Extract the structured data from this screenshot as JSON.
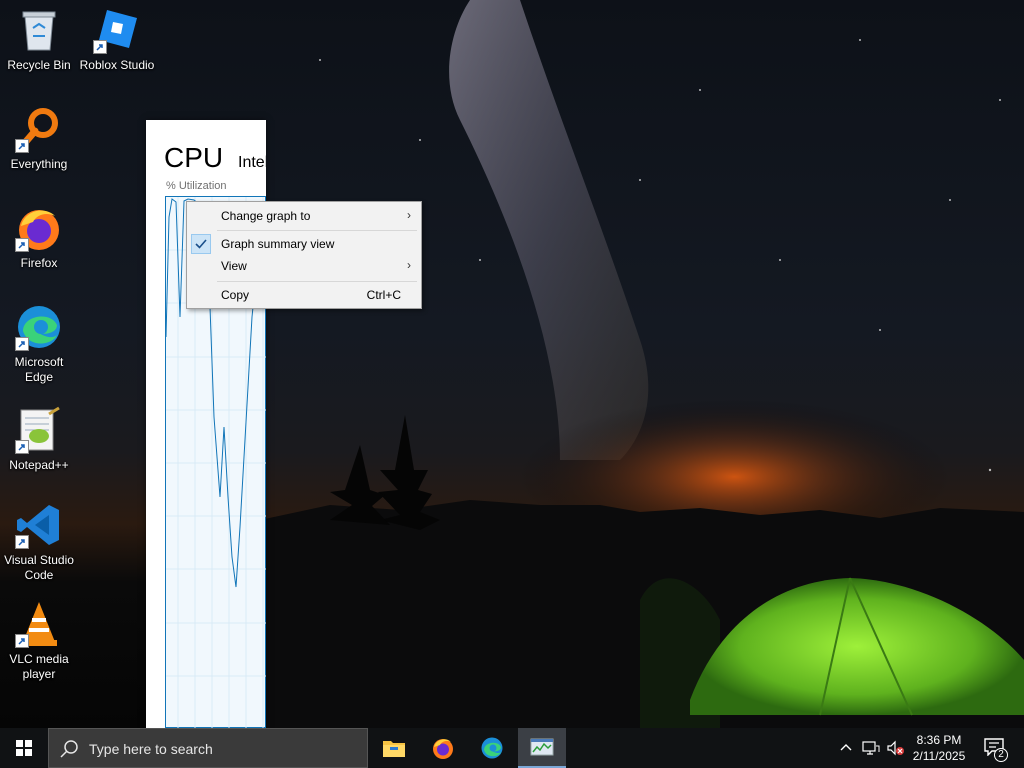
{
  "desktop": {
    "icons": [
      {
        "label": "Recycle Bin",
        "icon": "recycle-bin-icon"
      },
      {
        "label": "Roblox Studio",
        "icon": "roblox-studio-icon"
      },
      {
        "label": "Everything",
        "icon": "everything-search-icon"
      },
      {
        "label": "Firefox",
        "icon": "firefox-icon"
      },
      {
        "label": "Microsoft Edge",
        "icon": "edge-icon"
      },
      {
        "label": "Notepad++",
        "icon": "notepadpp-icon"
      },
      {
        "label": "Visual Studio Code",
        "icon": "vscode-icon"
      },
      {
        "label": "VLC media player",
        "icon": "vlc-icon"
      }
    ]
  },
  "task_manager": {
    "section_title": "CPU",
    "cpu_name_partial": "Intel",
    "utilization_label": "% Utilization",
    "graph_color": "#1175b8"
  },
  "context_menu": {
    "items": [
      {
        "label": "Change graph to",
        "submenu": true
      },
      {
        "label": "Graph summary view",
        "checked": true
      },
      {
        "label": "View",
        "submenu": true
      },
      {
        "label": "Copy",
        "shortcut": "Ctrl+C"
      }
    ],
    "submenu_arrow": "›"
  },
  "taskbar": {
    "search_placeholder": "Type here to search",
    "pinned": [
      {
        "name": "File Explorer",
        "icon": "file-explorer-icon"
      },
      {
        "name": "Firefox",
        "icon": "firefox-icon"
      },
      {
        "name": "Microsoft Edge",
        "icon": "edge-icon"
      },
      {
        "name": "Task Manager",
        "icon": "task-manager-icon",
        "active": true
      }
    ],
    "tray": {
      "time": "8:36 PM",
      "date": "2/11/2025",
      "notification_count": "2"
    }
  }
}
